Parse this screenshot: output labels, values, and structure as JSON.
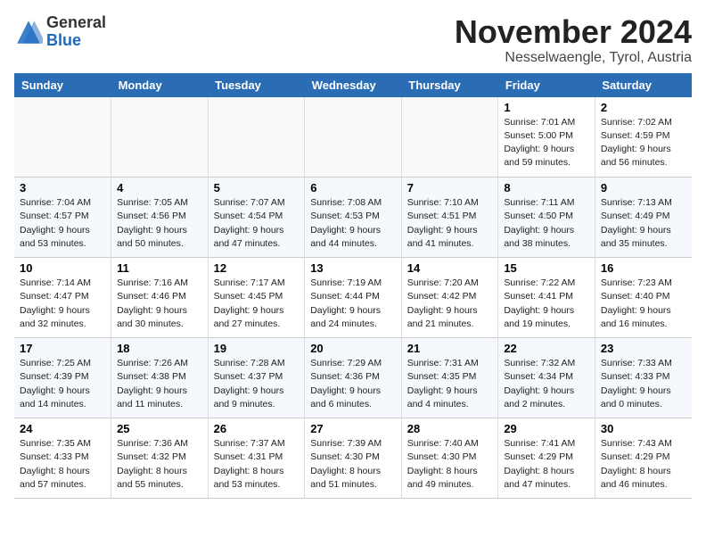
{
  "header": {
    "logo_general": "General",
    "logo_blue": "Blue",
    "month_year": "November 2024",
    "location": "Nesselwaengle, Tyrol, Austria"
  },
  "weekdays": [
    "Sunday",
    "Monday",
    "Tuesday",
    "Wednesday",
    "Thursday",
    "Friday",
    "Saturday"
  ],
  "weeks": [
    [
      {
        "day": "",
        "info": ""
      },
      {
        "day": "",
        "info": ""
      },
      {
        "day": "",
        "info": ""
      },
      {
        "day": "",
        "info": ""
      },
      {
        "day": "",
        "info": ""
      },
      {
        "day": "1",
        "info": "Sunrise: 7:01 AM\nSunset: 5:00 PM\nDaylight: 9 hours and 59 minutes."
      },
      {
        "day": "2",
        "info": "Sunrise: 7:02 AM\nSunset: 4:59 PM\nDaylight: 9 hours and 56 minutes."
      }
    ],
    [
      {
        "day": "3",
        "info": "Sunrise: 7:04 AM\nSunset: 4:57 PM\nDaylight: 9 hours and 53 minutes."
      },
      {
        "day": "4",
        "info": "Sunrise: 7:05 AM\nSunset: 4:56 PM\nDaylight: 9 hours and 50 minutes."
      },
      {
        "day": "5",
        "info": "Sunrise: 7:07 AM\nSunset: 4:54 PM\nDaylight: 9 hours and 47 minutes."
      },
      {
        "day": "6",
        "info": "Sunrise: 7:08 AM\nSunset: 4:53 PM\nDaylight: 9 hours and 44 minutes."
      },
      {
        "day": "7",
        "info": "Sunrise: 7:10 AM\nSunset: 4:51 PM\nDaylight: 9 hours and 41 minutes."
      },
      {
        "day": "8",
        "info": "Sunrise: 7:11 AM\nSunset: 4:50 PM\nDaylight: 9 hours and 38 minutes."
      },
      {
        "day": "9",
        "info": "Sunrise: 7:13 AM\nSunset: 4:49 PM\nDaylight: 9 hours and 35 minutes."
      }
    ],
    [
      {
        "day": "10",
        "info": "Sunrise: 7:14 AM\nSunset: 4:47 PM\nDaylight: 9 hours and 32 minutes."
      },
      {
        "day": "11",
        "info": "Sunrise: 7:16 AM\nSunset: 4:46 PM\nDaylight: 9 hours and 30 minutes."
      },
      {
        "day": "12",
        "info": "Sunrise: 7:17 AM\nSunset: 4:45 PM\nDaylight: 9 hours and 27 minutes."
      },
      {
        "day": "13",
        "info": "Sunrise: 7:19 AM\nSunset: 4:44 PM\nDaylight: 9 hours and 24 minutes."
      },
      {
        "day": "14",
        "info": "Sunrise: 7:20 AM\nSunset: 4:42 PM\nDaylight: 9 hours and 21 minutes."
      },
      {
        "day": "15",
        "info": "Sunrise: 7:22 AM\nSunset: 4:41 PM\nDaylight: 9 hours and 19 minutes."
      },
      {
        "day": "16",
        "info": "Sunrise: 7:23 AM\nSunset: 4:40 PM\nDaylight: 9 hours and 16 minutes."
      }
    ],
    [
      {
        "day": "17",
        "info": "Sunrise: 7:25 AM\nSunset: 4:39 PM\nDaylight: 9 hours and 14 minutes."
      },
      {
        "day": "18",
        "info": "Sunrise: 7:26 AM\nSunset: 4:38 PM\nDaylight: 9 hours and 11 minutes."
      },
      {
        "day": "19",
        "info": "Sunrise: 7:28 AM\nSunset: 4:37 PM\nDaylight: 9 hours and 9 minutes."
      },
      {
        "day": "20",
        "info": "Sunrise: 7:29 AM\nSunset: 4:36 PM\nDaylight: 9 hours and 6 minutes."
      },
      {
        "day": "21",
        "info": "Sunrise: 7:31 AM\nSunset: 4:35 PM\nDaylight: 9 hours and 4 minutes."
      },
      {
        "day": "22",
        "info": "Sunrise: 7:32 AM\nSunset: 4:34 PM\nDaylight: 9 hours and 2 minutes."
      },
      {
        "day": "23",
        "info": "Sunrise: 7:33 AM\nSunset: 4:33 PM\nDaylight: 9 hours and 0 minutes."
      }
    ],
    [
      {
        "day": "24",
        "info": "Sunrise: 7:35 AM\nSunset: 4:33 PM\nDaylight: 8 hours and 57 minutes."
      },
      {
        "day": "25",
        "info": "Sunrise: 7:36 AM\nSunset: 4:32 PM\nDaylight: 8 hours and 55 minutes."
      },
      {
        "day": "26",
        "info": "Sunrise: 7:37 AM\nSunset: 4:31 PM\nDaylight: 8 hours and 53 minutes."
      },
      {
        "day": "27",
        "info": "Sunrise: 7:39 AM\nSunset: 4:30 PM\nDaylight: 8 hours and 51 minutes."
      },
      {
        "day": "28",
        "info": "Sunrise: 7:40 AM\nSunset: 4:30 PM\nDaylight: 8 hours and 49 minutes."
      },
      {
        "day": "29",
        "info": "Sunrise: 7:41 AM\nSunset: 4:29 PM\nDaylight: 8 hours and 47 minutes."
      },
      {
        "day": "30",
        "info": "Sunrise: 7:43 AM\nSunset: 4:29 PM\nDaylight: 8 hours and 46 minutes."
      }
    ]
  ]
}
